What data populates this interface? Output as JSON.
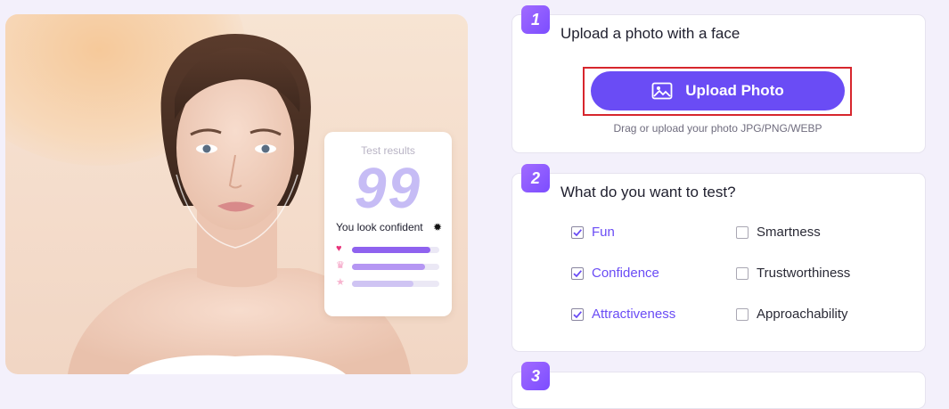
{
  "hero": {
    "result_card": {
      "title": "Test results",
      "score": "99",
      "message": "You look confident",
      "bars": [
        {
          "icon": "heart-icon",
          "glyph": "♥",
          "color": "#e8337a",
          "fill_color": "#8f62ef",
          "level": 0.9
        },
        {
          "icon": "crown-icon",
          "glyph": "♛",
          "color": "#f49ac0",
          "fill_color": "#b596f3",
          "level": 0.84
        },
        {
          "icon": "star-icon",
          "glyph": "★",
          "color": "#f7b4cf",
          "fill_color": "#cfc4f3",
          "level": 0.7
        }
      ]
    }
  },
  "steps": {
    "step1": {
      "number": "1",
      "title": "Upload a photo with a face",
      "upload_label": "Upload Photo",
      "hint": "Drag or upload your photo JPG/PNG/WEBP"
    },
    "step2": {
      "number": "2",
      "title": "What do you want to test?",
      "options": [
        {
          "label": "Fun",
          "checked": true
        },
        {
          "label": "Smartness",
          "checked": false
        },
        {
          "label": "Confidence",
          "checked": true
        },
        {
          "label": "Trustworthiness",
          "checked": false
        },
        {
          "label": "Attractiveness",
          "checked": true
        },
        {
          "label": "Approachability",
          "checked": false
        }
      ]
    },
    "step3": {
      "number": "3"
    }
  },
  "colors": {
    "accent": "#6a4cf5",
    "highlight_outline": "#d7262d",
    "badge": "#8a5cff"
  }
}
